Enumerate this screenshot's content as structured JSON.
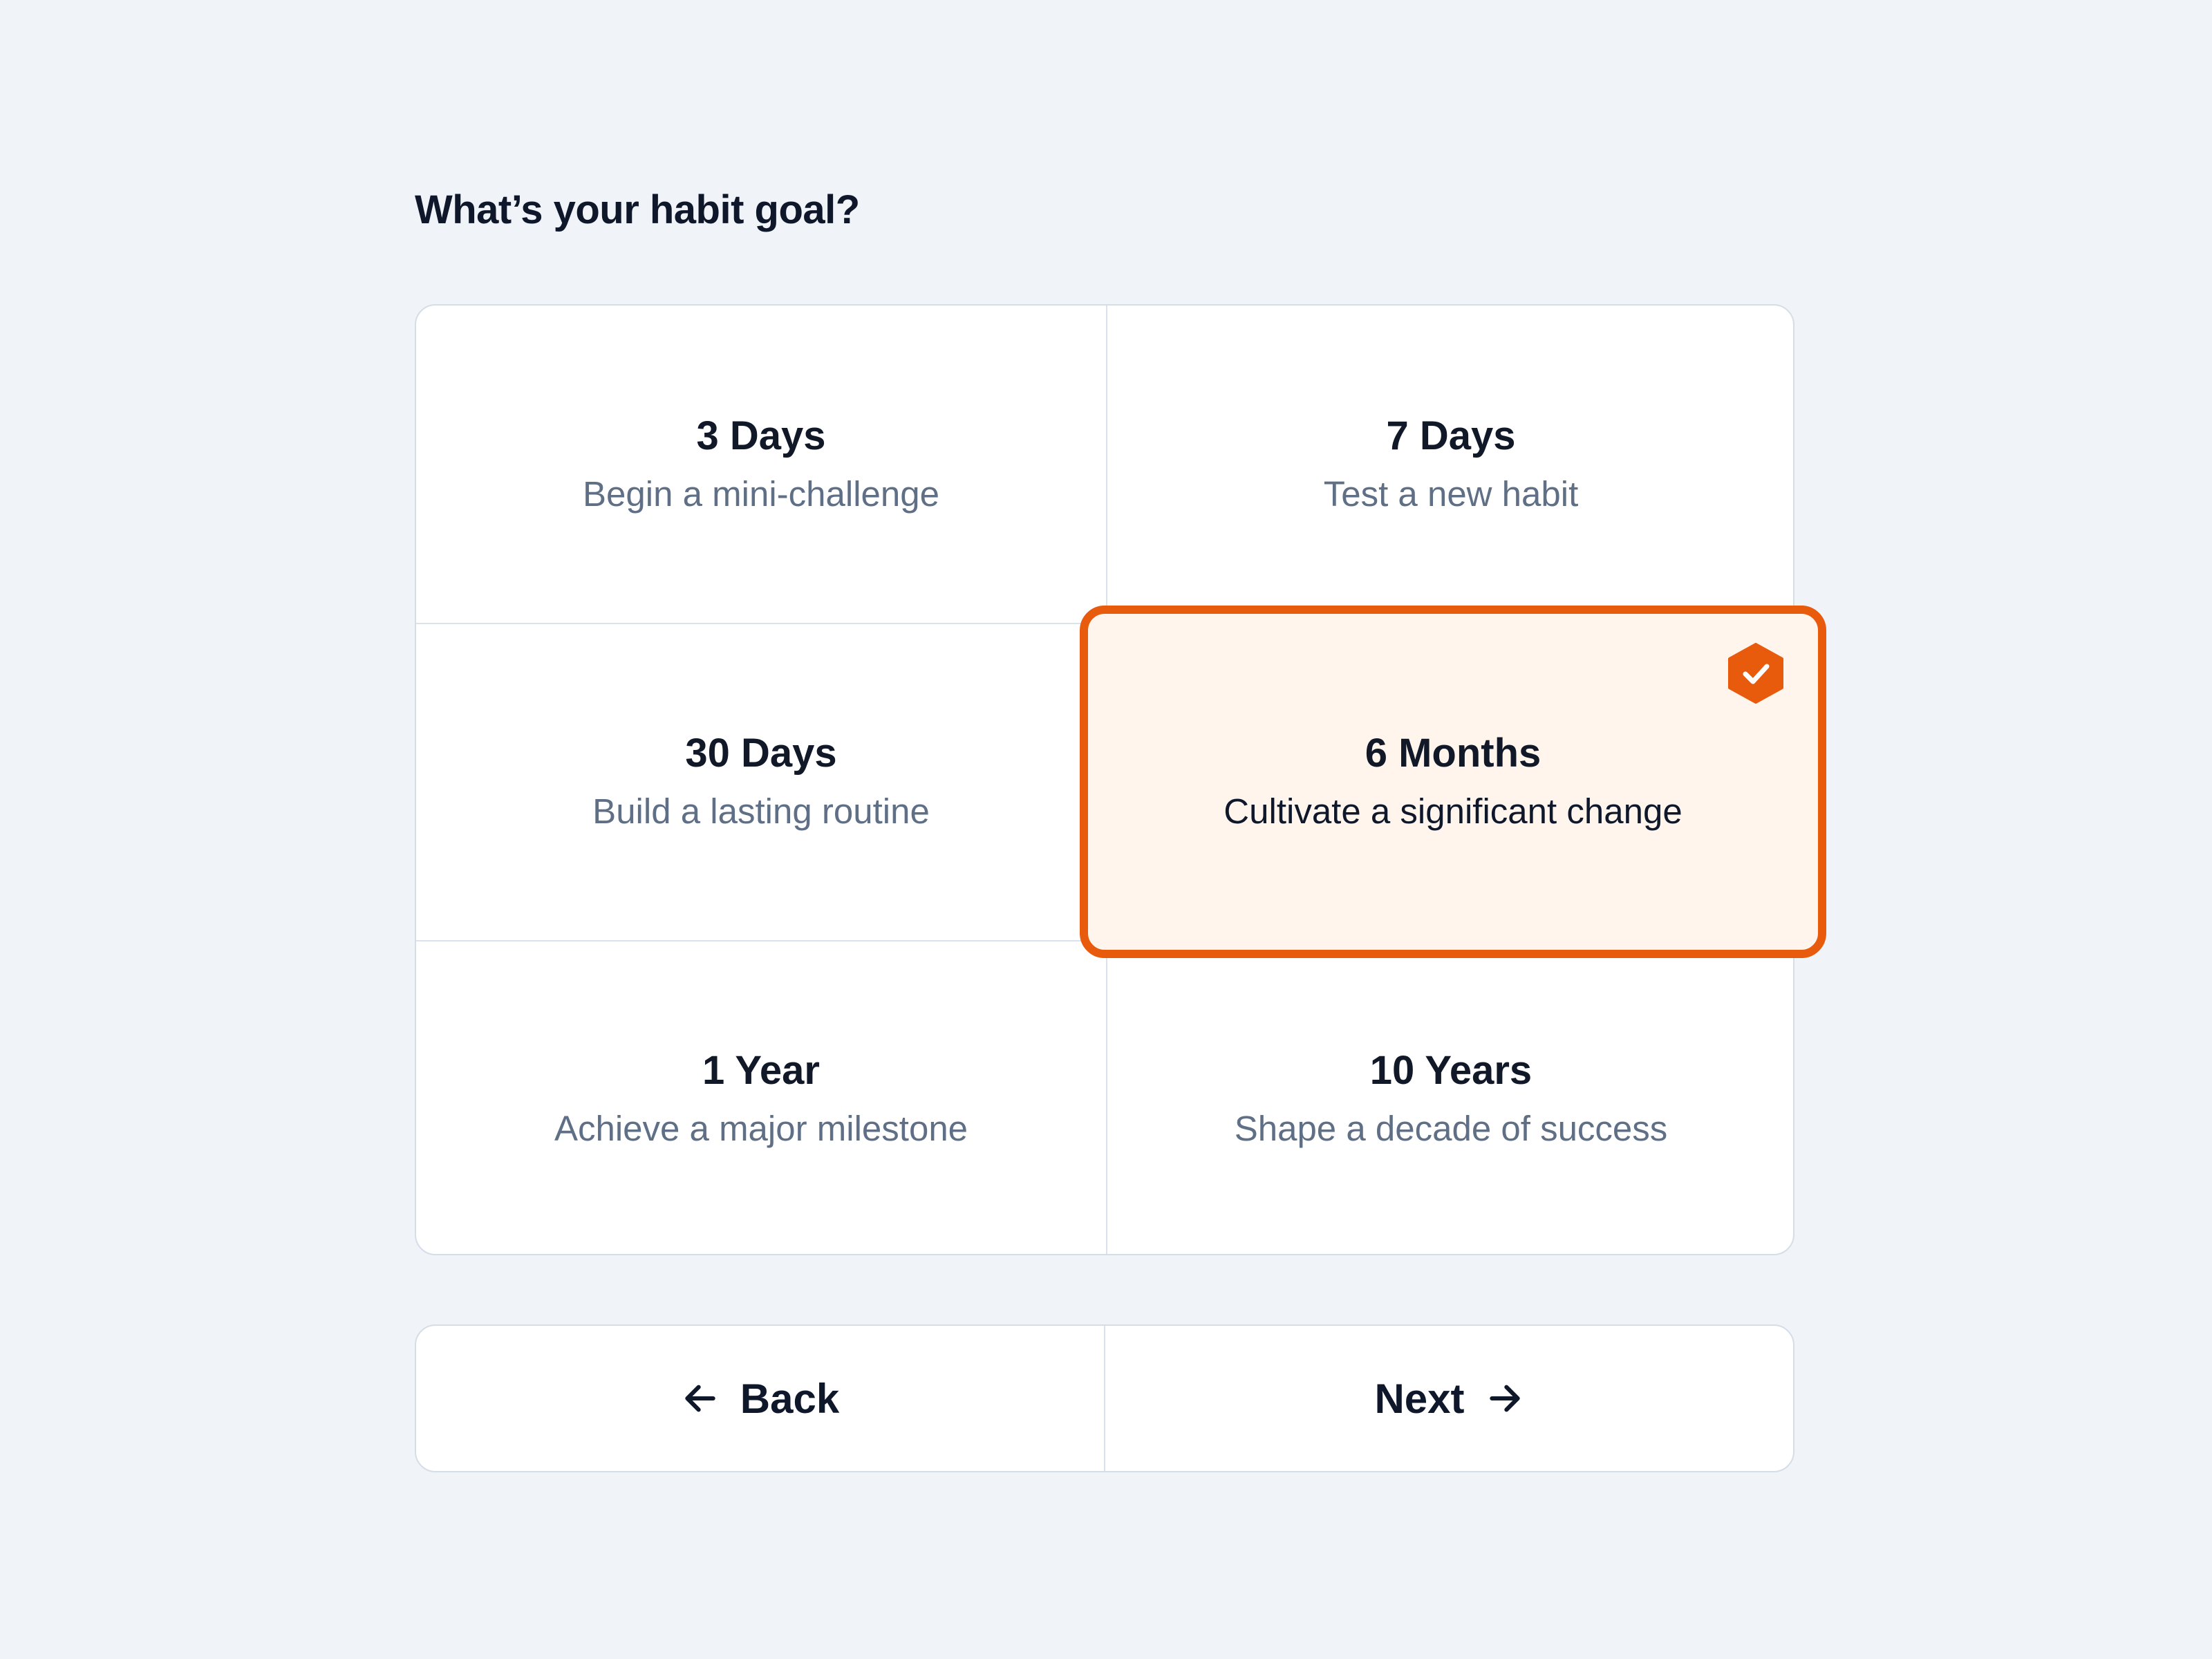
{
  "question": "What’s your habit goal?",
  "options": [
    {
      "title": "3 Days",
      "subtitle": "Begin a mini-challenge"
    },
    {
      "title": "7 Days",
      "subtitle": "Test a new habit"
    },
    {
      "title": "30 Days",
      "subtitle": "Build a lasting routine"
    },
    {
      "title": "6 Months",
      "subtitle": "Cultivate a significant change",
      "selected": true
    },
    {
      "title": "1 Year",
      "subtitle": "Achieve a major milestone"
    },
    {
      "title": "10 Years",
      "subtitle": "Shape a decade of success"
    }
  ],
  "nav": {
    "back_label": "Back",
    "next_label": "Next",
    "back_icon": "arrow-left-icon",
    "next_icon": "arrow-right-icon"
  },
  "selected_badge_icon": "check-badge-icon",
  "colors": {
    "accent": "#e85a0c",
    "selected_bg": "#fff5ec",
    "page_bg": "#f0f4f9",
    "muted_text": "#5f6f86",
    "text": "#0f172a"
  }
}
